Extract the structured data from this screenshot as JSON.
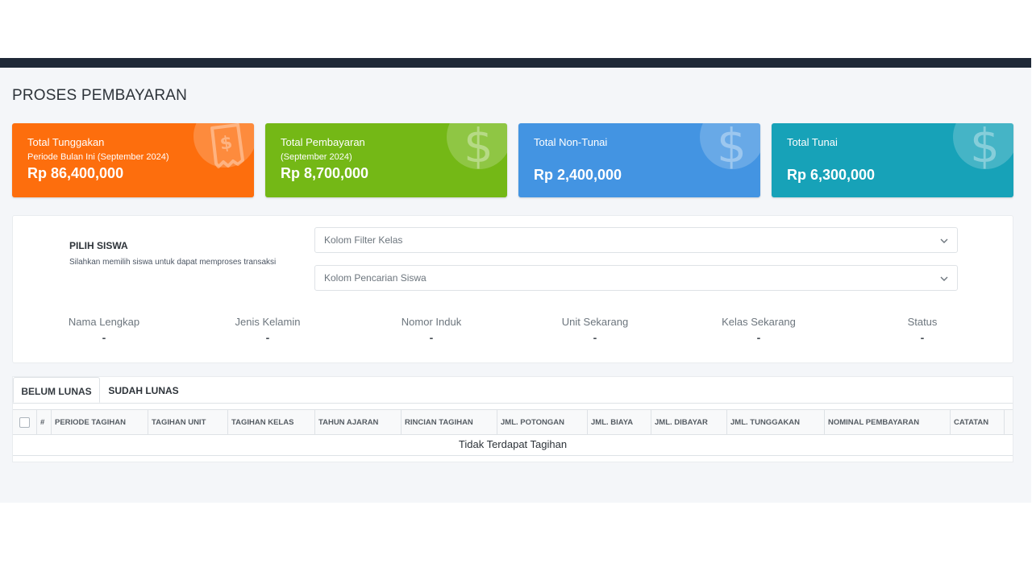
{
  "page": {
    "title": "PROSES PEMBAYARAN"
  },
  "cards": [
    {
      "title": "Total Tunggakan",
      "subtitle": "Periode Bulan Ini (September 2024)",
      "amount": "Rp 86,400,000",
      "icon": "receipt-dollar-icon",
      "color": "#fd6e0d"
    },
    {
      "title": "Total Pembayaran",
      "subtitle": "(September 2024)",
      "amount": "Rp 8,700,000",
      "icon": "dollar-icon",
      "color": "#74b816"
    },
    {
      "title": "Total Non-Tunai",
      "amount": "Rp 2,400,000",
      "icon": "dollar-icon",
      "color": "#4394e2"
    },
    {
      "title": "Total Tunai",
      "amount": "Rp 6,300,000",
      "icon": "dollar-icon",
      "color": "#17a2b8"
    }
  ],
  "student": {
    "title": "PILIH SISWA",
    "description": "Silahkan memilih siswa untuk dapat memproses transaksi",
    "filter_class_placeholder": "Kolom Filter Kelas",
    "search_student_placeholder": "Kolom Pencarian Siswa",
    "info": [
      {
        "label": "Nama Lengkap",
        "value": "-"
      },
      {
        "label": "Jenis Kelamin",
        "value": "-"
      },
      {
        "label": "Nomor Induk",
        "value": "-"
      },
      {
        "label": "Unit Sekarang",
        "value": "-"
      },
      {
        "label": "Kelas Sekarang",
        "value": "-"
      },
      {
        "label": "Status",
        "value": "-"
      }
    ]
  },
  "tabs": [
    {
      "label": "BELUM LUNAS",
      "active": true
    },
    {
      "label": "SUDAH LUNAS",
      "active": false
    }
  ],
  "table": {
    "columns": [
      "#",
      "PERIODE TAGIHAN",
      "TAGIHAN UNIT",
      "TAGIHAN KELAS",
      "TAHUN AJARAN",
      "RINCIAN TAGIHAN",
      "JML. POTONGAN",
      "JML. BIAYA",
      "JML. DIBAYAR",
      "JML. TUNGGAKAN",
      "NOMINAL PEMBAYARAN",
      "CATATAN"
    ],
    "empty_message": "Tidak Terdapat Tagihan"
  }
}
